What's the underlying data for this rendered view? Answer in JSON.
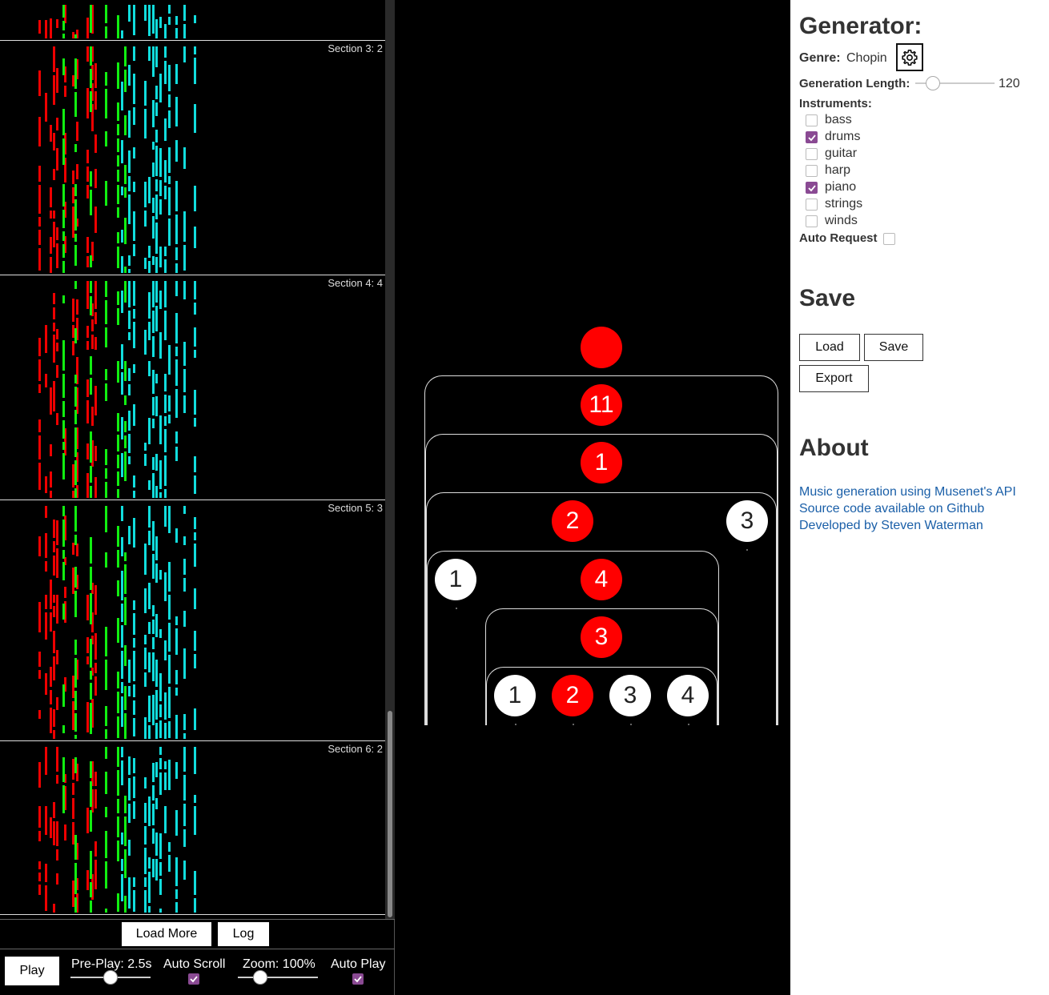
{
  "roll": {
    "sections": [
      {
        "label": "Section 3: 2"
      },
      {
        "label": "Section 4: 4"
      },
      {
        "label": "Section 5: 3"
      },
      {
        "label": "Section 6: 2"
      }
    ],
    "colors": {
      "red": "#ee0000",
      "green": "#11ee11",
      "cyan": "#11dddd"
    }
  },
  "buttons": {
    "load_more": "Load More",
    "log": "Log",
    "play": "Play"
  },
  "controls": {
    "preplay_label": "Pre-Play: 2.5s",
    "preplay_level": 0.5,
    "autoscroll_label": "Auto Scroll",
    "autoscroll_checked": true,
    "zoom_label": "Zoom: 100%",
    "zoom_level": 0.28,
    "autoplay_label": "Auto Play",
    "autoplay_checked": true
  },
  "tree": {
    "rows": [
      {
        "nodes": [
          {
            "label": "",
            "color": "red"
          }
        ]
      },
      {
        "nodes": [
          {
            "label": "11",
            "color": "red"
          }
        ]
      },
      {
        "nodes": [
          {
            "label": "1",
            "color": "red"
          }
        ]
      },
      {
        "nodes": [
          {
            "label": "2",
            "color": "red"
          },
          {
            "label": "3",
            "color": "white"
          }
        ]
      },
      {
        "nodes": [
          {
            "label": "1",
            "color": "white"
          },
          {
            "label": "4",
            "color": "red"
          }
        ]
      },
      {
        "nodes": [
          {
            "label": "3",
            "color": "red"
          }
        ]
      },
      {
        "nodes": [
          {
            "label": "1",
            "color": "white"
          },
          {
            "label": "2",
            "color": "red"
          },
          {
            "label": "3",
            "color": "white"
          },
          {
            "label": "4",
            "color": "white"
          }
        ]
      }
    ]
  },
  "generator": {
    "title": "Generator:",
    "genre_label": "Genre:",
    "genre_value": "Chopin",
    "settings_icon": "gear-icon",
    "length_label": "Generation Length:",
    "length_value": "120",
    "length_level": 0.22,
    "instruments_label": "Instruments:",
    "instruments": [
      {
        "name": "bass",
        "checked": false
      },
      {
        "name": "drums",
        "checked": true
      },
      {
        "name": "guitar",
        "checked": false
      },
      {
        "name": "harp",
        "checked": false
      },
      {
        "name": "piano",
        "checked": true
      },
      {
        "name": "strings",
        "checked": false
      },
      {
        "name": "winds",
        "checked": false
      }
    ],
    "auto_request_label": "Auto Request",
    "auto_request_checked": false
  },
  "save": {
    "title": "Save",
    "load": "Load",
    "save": "Save",
    "export": "Export"
  },
  "about": {
    "title": "About",
    "links": [
      "Music generation using Musenet's API",
      "Source code available on Github",
      "Developed by Steven Waterman"
    ]
  },
  "accent": "#8a4a93",
  "link_color": "#1a5fa8"
}
